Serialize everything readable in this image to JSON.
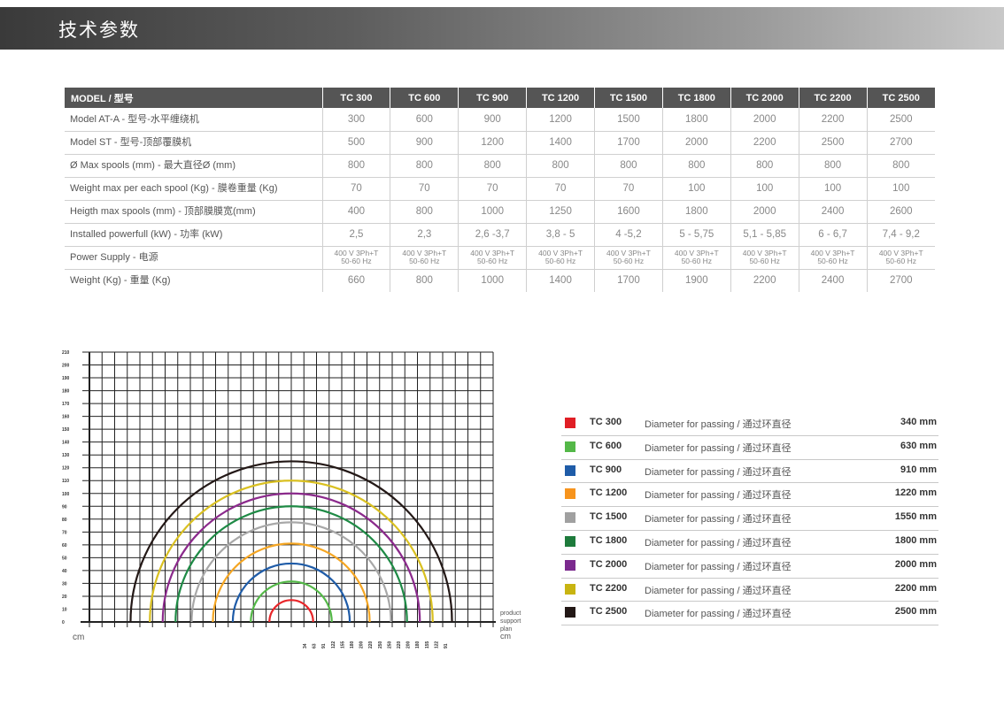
{
  "header": {
    "title": "技术参数"
  },
  "table": {
    "columns": [
      "MODEL / 型号",
      "TC 300",
      "TC 600",
      "TC 900",
      "TC 1200",
      "TC 1500",
      "TC 1800",
      "TC 2000",
      "TC 2200",
      "TC 2500"
    ],
    "rows": [
      {
        "label": "Model AT-A - 型号-水平缠绕机",
        "values": [
          "300",
          "600",
          "900",
          "1200",
          "1500",
          "1800",
          "2000",
          "2200",
          "2500"
        ]
      },
      {
        "label": "Model ST - 型号-顶部覆膜机",
        "values": [
          "500",
          "900",
          "1200",
          "1400",
          "1700",
          "2000",
          "2200",
          "2500",
          "2700"
        ]
      },
      {
        "label": "Ø Max spools (mm) - 最大直径Ø (mm)",
        "values": [
          "800",
          "800",
          "800",
          "800",
          "800",
          "800",
          "800",
          "800",
          "800"
        ]
      },
      {
        "label": "Weight max per each spool (Kg) - 膜卷重量 (Kg)",
        "values": [
          "70",
          "70",
          "70",
          "70",
          "70",
          "100",
          "100",
          "100",
          "100"
        ]
      },
      {
        "label": "Heigth max spools (mm) - 顶部膜膜宽(mm)",
        "values": [
          "400",
          "800",
          "1000",
          "1250",
          "1600",
          "1800",
          "2000",
          "2400",
          "2600"
        ]
      },
      {
        "label": "Installed powerfull (kW) - 功率 (kW)",
        "values": [
          "2,5",
          "2,3",
          "2,6 -3,7",
          "3,8 - 5",
          "4 -5,2",
          "5 - 5,75",
          "5,1 - 5,85",
          "6 - 6,7",
          "7,4 - 9,2"
        ]
      },
      {
        "label": "Power Supply - 电源",
        "values": [
          "400 V 3Ph+T",
          "400 V 3Ph+T",
          "400 V 3Ph+T",
          "400 V 3Ph+T",
          "400 V 3Ph+T",
          "400 V 3Ph+T",
          "400 V 3Ph+T",
          "400 V 3Ph+T",
          "400 V 3Ph+T"
        ],
        "values2": [
          "50-60 Hz",
          "50-60 Hz",
          "50-60 Hz",
          "50-60 Hz",
          "50-60 Hz",
          "50-60 Hz",
          "50-60 Hz",
          "50-60 Hz",
          "50-60 Hz"
        ]
      },
      {
        "label": "Weight (Kg) - 重量 (Kg)",
        "values": [
          "660",
          "800",
          "1000",
          "1400",
          "1700",
          "1900",
          "2200",
          "2400",
          "2700"
        ]
      }
    ]
  },
  "diagram": {
    "unit": "cm",
    "y_ticks": [
      "0",
      "10",
      "20",
      "30",
      "40",
      "50",
      "60",
      "70",
      "80",
      "90",
      "100",
      "110",
      "120",
      "130",
      "140",
      "150",
      "160",
      "170",
      "180",
      "190",
      "200",
      "210"
    ],
    "plane_label": [
      "product",
      "support",
      "plan",
      "cm"
    ],
    "x_marks": [
      "34",
      "63",
      "91",
      "122",
      "155",
      "180",
      "200",
      "220",
      "250",
      "250",
      "220",
      "200",
      "180",
      "155",
      "122",
      "91"
    ],
    "circles": [
      {
        "model": "TC 300",
        "diameter_cm": 34,
        "color": "#e8262a"
      },
      {
        "model": "TC 600",
        "diameter_cm": 63,
        "color": "#54b848"
      },
      {
        "model": "TC 900",
        "diameter_cm": 91,
        "color": "#1f5ca8"
      },
      {
        "model": "TC 1200",
        "diameter_cm": 122,
        "color": "#f5a623"
      },
      {
        "model": "TC 1500",
        "diameter_cm": 155,
        "color": "#a8a8a8"
      },
      {
        "model": "TC 1800",
        "diameter_cm": 180,
        "color": "#1e8a45"
      },
      {
        "model": "TC 2000",
        "diameter_cm": 200,
        "color": "#8b2a8c"
      },
      {
        "model": "TC 2200",
        "diameter_cm": 220,
        "color": "#d9c021"
      },
      {
        "model": "TC 2500",
        "diameter_cm": 250,
        "color": "#231816"
      }
    ]
  },
  "legend": [
    {
      "model": "TC 300",
      "desc": "Diameter for passing / 通过环直径",
      "value": "340 mm",
      "color": "#e01e25"
    },
    {
      "model": "TC 600",
      "desc": "Diameter for passing / 通过环直径",
      "value": "630 mm",
      "color": "#54b848"
    },
    {
      "model": "TC 900",
      "desc": "Diameter for passing / 通过环直径",
      "value": "910 mm",
      "color": "#1f5ca8"
    },
    {
      "model": "TC 1200",
      "desc": "Diameter for passing / 通过环直径",
      "value": "1220 mm",
      "color": "#f7941d"
    },
    {
      "model": "TC 1500",
      "desc": "Diameter for passing / 通过环直径",
      "value": "1550 mm",
      "color": "#a0a0a0"
    },
    {
      "model": "TC 1800",
      "desc": "Diameter for passing / 通过环直径",
      "value": "1800 mm",
      "color": "#1e7b3c"
    },
    {
      "model": "TC 2000",
      "desc": "Diameter for passing / 通过环直径",
      "value": "2000 mm",
      "color": "#7b2a8e"
    },
    {
      "model": "TC 2200",
      "desc": "Diameter for passing / 通过环直径",
      "value": "2200 mm",
      "color": "#c8b411"
    },
    {
      "model": "TC 2500",
      "desc": "Diameter for passing / 通过环直径",
      "value": "2500 mm",
      "color": "#231816"
    }
  ]
}
